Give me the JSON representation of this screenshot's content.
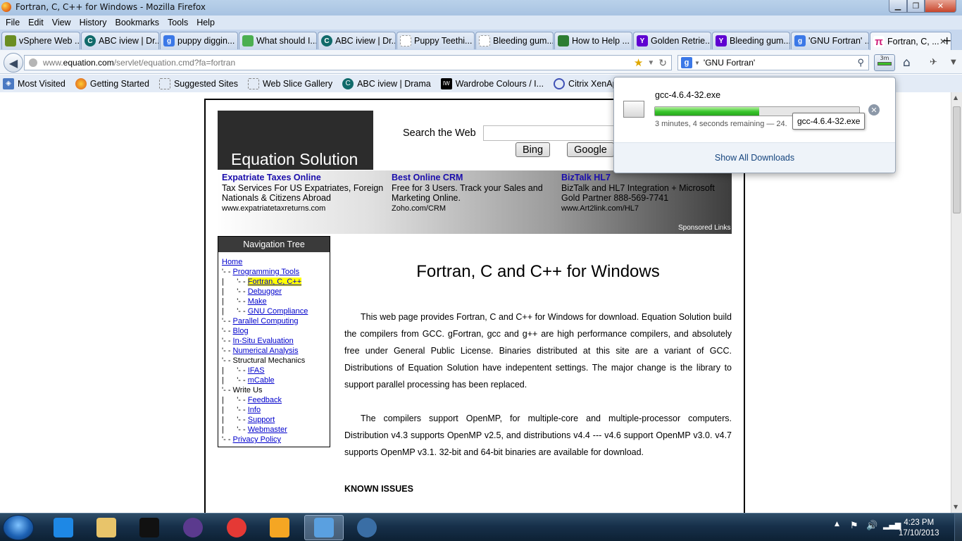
{
  "window": {
    "title": "Fortran, C, C++ for Windows - Mozilla Firefox"
  },
  "menu": [
    "File",
    "Edit",
    "View",
    "History",
    "Bookmarks",
    "Tools",
    "Help"
  ],
  "tabs": [
    {
      "label": "vSphere Web ...",
      "icon": "vsphere-icon",
      "color": "#6b8e23"
    },
    {
      "label": "ABC iview | Dr...",
      "icon": "abc-iview-icon",
      "color": "#106a6a"
    },
    {
      "label": "puppy diggin...",
      "icon": "google-icon",
      "color": "#3b78e7"
    },
    {
      "label": "What should I...",
      "icon": "clover-icon",
      "color": "#4caf50"
    },
    {
      "label": "ABC iview | Dr...",
      "icon": "abc-iview-icon",
      "color": "#106a6a"
    },
    {
      "label": "Puppy Teethi...",
      "icon": "blank-page-icon",
      "color": "#cccccc"
    },
    {
      "label": "Bleeding gum...",
      "icon": "blank-page-icon",
      "color": "#cccccc"
    },
    {
      "label": "How to Help ...",
      "icon": "paw-icon",
      "color": "#2e7d32"
    },
    {
      "label": "Golden Retrie...",
      "icon": "yahoo-icon",
      "color": "#5f01d1"
    },
    {
      "label": "Bleeding gum...",
      "icon": "yahoo-icon",
      "color": "#5f01d1"
    },
    {
      "label": "'GNU Fortran' ...",
      "icon": "google-icon",
      "color": "#3b78e7"
    },
    {
      "label": "Fortran, C, ...",
      "icon": "pi-icon",
      "color": "#ffffff",
      "active": true
    }
  ],
  "address": {
    "prefix": "www.",
    "host": "equation.com",
    "rest": "/servlet/equation.cmd?fa=fortran"
  },
  "search": {
    "value": "'GNU Fortran'"
  },
  "download_button": {
    "label": "3m"
  },
  "bookmarks": [
    {
      "label": "Most Visited",
      "icon": "most-visited-icon"
    },
    {
      "label": "Getting Started",
      "icon": "firefox-icon"
    },
    {
      "label": "Suggested Sites",
      "icon": "blank-page-icon"
    },
    {
      "label": "Web Slice Gallery",
      "icon": "blank-page-icon"
    },
    {
      "label": "ABC iview | Drama",
      "icon": "abc-iview-icon"
    },
    {
      "label": "Wardrobe Colours / I...",
      "icon": "iw-icon"
    },
    {
      "label": "Citrix XenApp - Logon",
      "icon": "citrix-icon"
    }
  ],
  "page": {
    "logo": "Equation Solution",
    "search_label": "Search the Web",
    "bing": "Bing",
    "google": "Google",
    "ads": [
      {
        "title": "Expatriate Taxes Online",
        "desc": "Tax Services For US Expatriates, Foreign Nationals & Citizens Abroad",
        "url": "www.expatriatetaxreturns.com"
      },
      {
        "title": "Best Online CRM",
        "desc": "Free for 3 Users. Track your Sales and Marketing Online.",
        "url": "Zoho.com/CRM"
      },
      {
        "title": "BizTalk HL7",
        "desc": "BizTalk and HL7 Integration + Microsoft Gold Partner 888-569-7741",
        "url": "www.Art2link.com/HL7"
      }
    ],
    "sponsored": "Sponsored Links",
    "nav_title": "Navigation Tree",
    "nav": [
      {
        "prefix": "",
        "label": "Home",
        "link": true
      },
      {
        "prefix": "'- - ",
        "label": "Programming Tools",
        "link": true
      },
      {
        "prefix": "|      '- - ",
        "label": "Fortran, C, C++",
        "link": true,
        "current": true
      },
      {
        "prefix": "|      '- - ",
        "label": "Debugger",
        "link": true
      },
      {
        "prefix": "|      '- - ",
        "label": "Make",
        "link": true
      },
      {
        "prefix": "|      '- - ",
        "label": "GNU Compliance",
        "link": true
      },
      {
        "prefix": "'- - ",
        "label": "Parallel Computing",
        "link": true
      },
      {
        "prefix": "'- - ",
        "label": "Blog",
        "link": true
      },
      {
        "prefix": "'- - ",
        "label": "In-Situ Evaluation",
        "link": true
      },
      {
        "prefix": "'- - ",
        "label": "Numerical Analysis",
        "link": true
      },
      {
        "prefix": "'- - ",
        "label": "Structural Mechanics",
        "link": false
      },
      {
        "prefix": "|      '- - ",
        "label": "IFAS",
        "link": true
      },
      {
        "prefix": "|      '- - ",
        "label": "mCable",
        "link": true
      },
      {
        "prefix": "'- - ",
        "label": "Write Us",
        "link": false
      },
      {
        "prefix": "|      '- - ",
        "label": "Feedback",
        "link": true
      },
      {
        "prefix": "|      '- - ",
        "label": "Info",
        "link": true
      },
      {
        "prefix": "|      '- - ",
        "label": "Support",
        "link": true
      },
      {
        "prefix": "|      '- - ",
        "label": "Webmaster",
        "link": true
      },
      {
        "prefix": "'- - ",
        "label": "Privacy Policy",
        "link": true
      }
    ],
    "heading": "Fortran, C and C++ for Windows",
    "para1": "This web page provides Fortran, C and C++ for Windows for download. Equation Solution build the compilers from GCC. gFortran, gcc and g++ are high performance compilers, and absolutely free under General Public License. Binaries distributed at this site are a variant of GCC. Distributions of Equation Solution have indepentent settings. The major change is the library to support parallel processing has been replaced.",
    "para2": "The compilers support OpenMP, for multiple-core and multiple-processor computers. Distribution v4.3 supports OpenMP v2.5, and distributions v4.4 --- v4.6 support OpenMP v3.0. v4.7 supports OpenMP v3.1. 32-bit and 64-bit binaries are available for download.",
    "known_issues": "KNOWN ISSUES"
  },
  "download_panel": {
    "filename": "gcc-4.6.4-32.exe",
    "progress": 0.51,
    "status": "3 minutes, 4 seconds remaining — 24.",
    "show_all": "Show All Downloads",
    "tooltip": "gcc-4.6.4-32.exe"
  },
  "taskbar": {
    "time": "4:23 PM",
    "date": "17/10/2013",
    "apps": [
      {
        "name": "ie-icon",
        "color": "#1e88e5"
      },
      {
        "name": "file-explorer-icon",
        "color": "#e8c46a"
      },
      {
        "name": "console-icon",
        "color": "#111111"
      },
      {
        "name": "eclipse-icon",
        "color": "#5b3a8e"
      },
      {
        "name": "chrome-icon",
        "color": "#e53935"
      },
      {
        "name": "media-player-icon",
        "color": "#f5a623"
      },
      {
        "name": "magnifier-icon",
        "color": "#5aa0e0",
        "active": true
      },
      {
        "name": "network-app-icon",
        "color": "#3a6ea5"
      }
    ]
  }
}
